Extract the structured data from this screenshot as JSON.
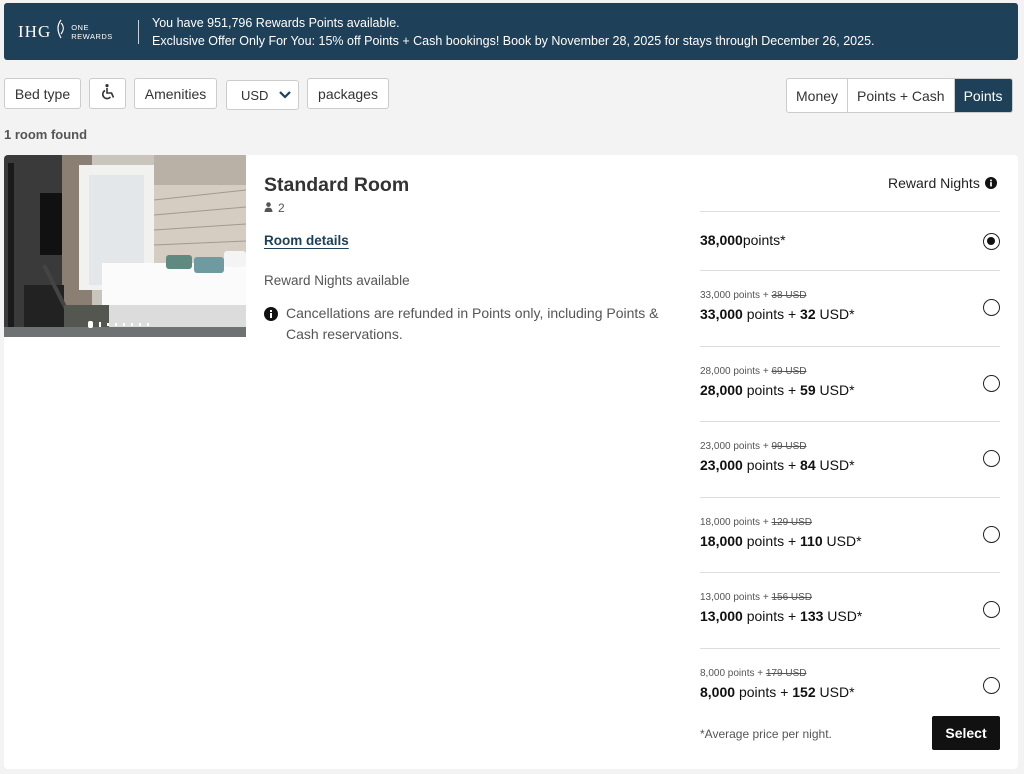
{
  "banner": {
    "brand": "IHG",
    "brand_sub_line1": "ONE",
    "brand_sub_line2": "REWARDS",
    "line1": "You have 951,796 Rewards Points available.",
    "line2": "Exclusive Offer Only For You: 15% off Points + Cash bookings! Book by November 28, 2025 for stays through December 26, 2025."
  },
  "filters": {
    "bed_type": "Bed type",
    "accessibility_icon": "wheelchair-icon",
    "amenities": "Amenities",
    "currency": "USD",
    "packages": "packages"
  },
  "payment_toggle": {
    "options": [
      "Money",
      "Points + Cash",
      "Points"
    ],
    "selected": "Points",
    "active_color": "#1e4058"
  },
  "rooms_found": "1 room found",
  "room": {
    "title": "Standard Room",
    "occupancy": "2",
    "details_link": "Room details",
    "availability": "Reward Nights available",
    "cancellation": "Cancellations are refunded in Points only, including Points & Cash reservations.",
    "carousel_total": 8,
    "carousel_current": 1
  },
  "rates": {
    "header": "Reward Nights",
    "options": [
      {
        "points": "38,000",
        "points_label": "points*",
        "original": null,
        "cash": null,
        "selected": true
      },
      {
        "original": "33,000 points + ",
        "original_cash": "38 USD",
        "points": "33,000",
        "points_label": "points",
        "plus": "+",
        "cash": "32",
        "cash_label": "USD*",
        "selected": false
      },
      {
        "original": "28,000 points + ",
        "original_cash": "69 USD",
        "points": "28,000",
        "points_label": "points",
        "plus": "+",
        "cash": "59",
        "cash_label": "USD*",
        "selected": false
      },
      {
        "original": "23,000 points + ",
        "original_cash": "99 USD",
        "points": "23,000",
        "points_label": "points",
        "plus": "+",
        "cash": "84",
        "cash_label": "USD*",
        "selected": false
      },
      {
        "original": "18,000 points + ",
        "original_cash": "129 USD",
        "points": "18,000",
        "points_label": "points",
        "plus": "+",
        "cash": "110",
        "cash_label": "USD*",
        "selected": false
      },
      {
        "original": "13,000 points + ",
        "original_cash": "156 USD",
        "points": "13,000",
        "points_label": "points",
        "plus": "+",
        "cash": "133",
        "cash_label": "USD*",
        "selected": false
      },
      {
        "original": "8,000 points + ",
        "original_cash": "179 USD",
        "points": "8,000",
        "points_label": "points",
        "plus": "+",
        "cash": "152",
        "cash_label": "USD*",
        "selected": false
      }
    ],
    "note": "*Average price per night.",
    "select_label": "Select"
  }
}
